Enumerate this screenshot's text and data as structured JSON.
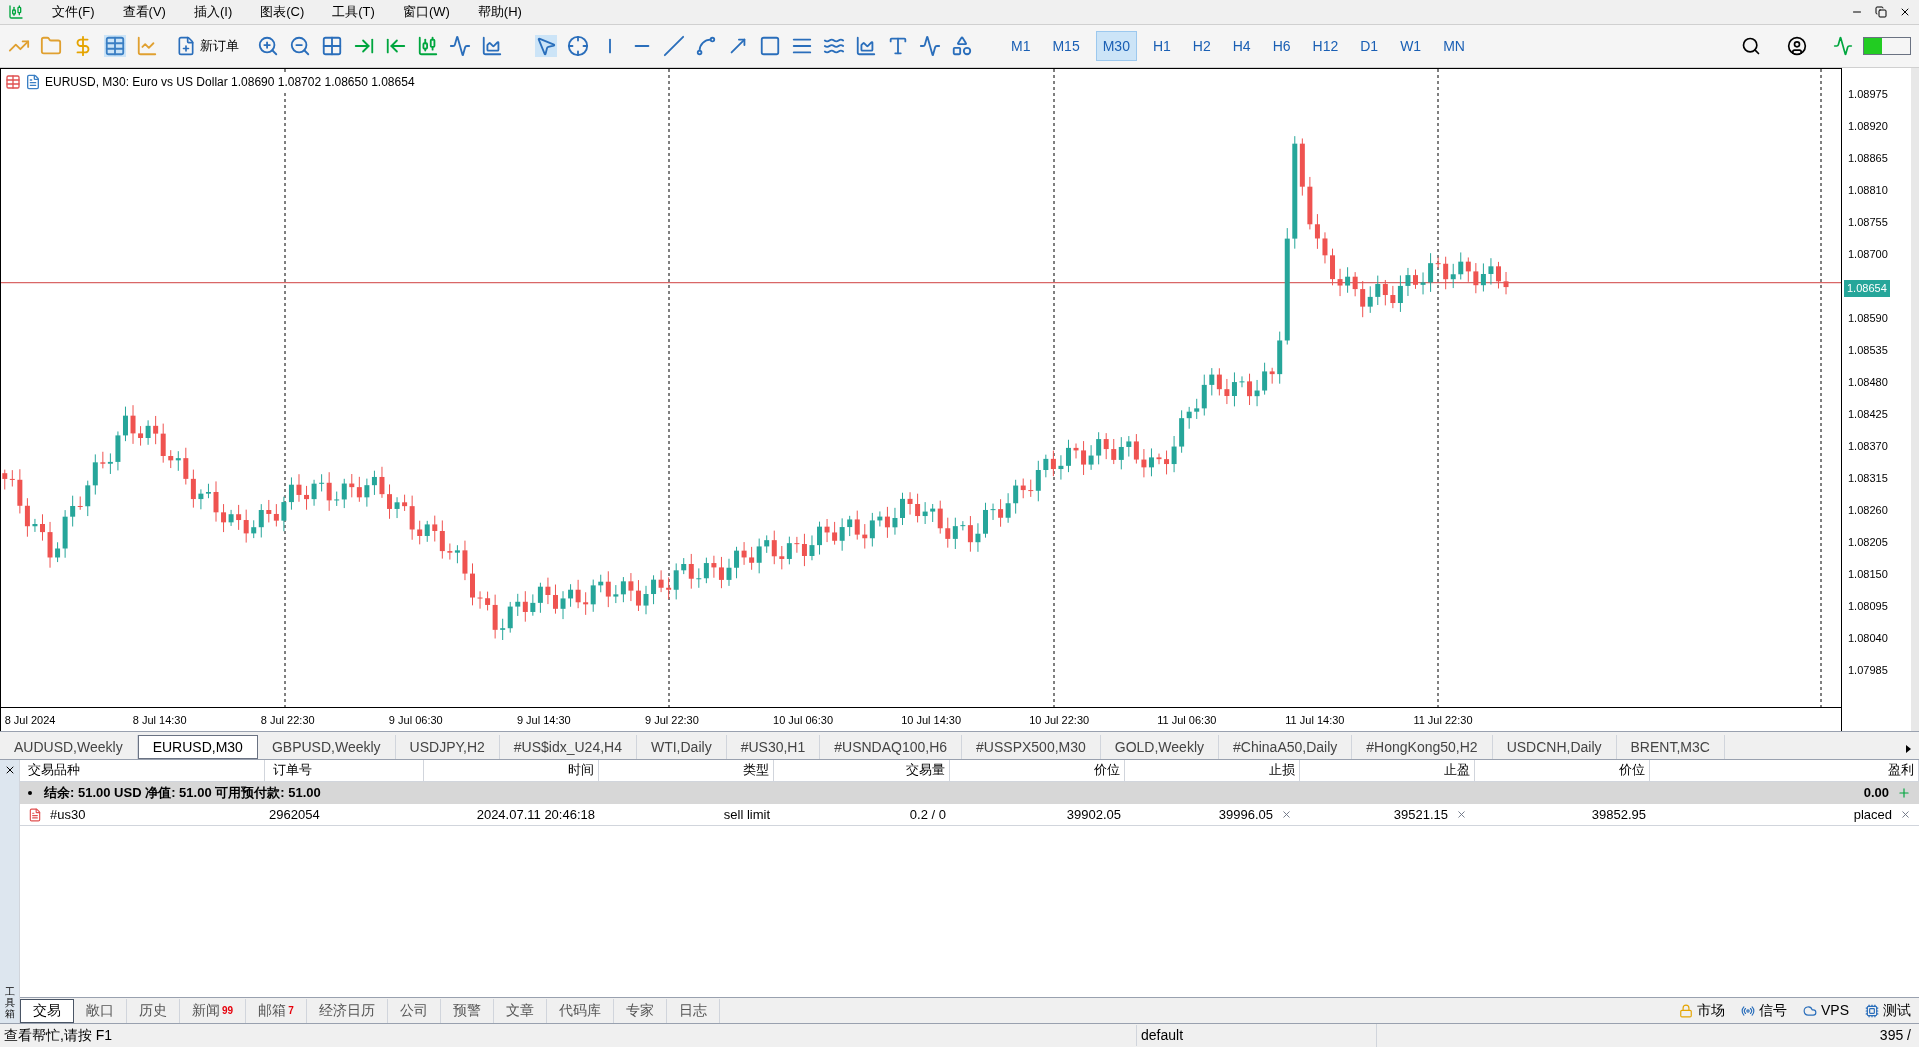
{
  "menu": [
    "文件(F)",
    "查看(V)",
    "插入(I)",
    "图表(C)",
    "工具(T)",
    "窗口(W)",
    "帮助(H)"
  ],
  "toolbar": {
    "new_order": "新订单",
    "timeframes": [
      {
        "label": "M1",
        "selected": false
      },
      {
        "label": "M15",
        "selected": false
      },
      {
        "label": "M30",
        "selected": true
      },
      {
        "label": "H1",
        "selected": false
      },
      {
        "label": "H2",
        "selected": false
      },
      {
        "label": "H4",
        "selected": false
      },
      {
        "label": "H6",
        "selected": false
      },
      {
        "label": "H12",
        "selected": false
      },
      {
        "label": "D1",
        "selected": false
      },
      {
        "label": "W1",
        "selected": false
      },
      {
        "label": "MN",
        "selected": false
      }
    ]
  },
  "chart": {
    "legend": "EURUSD, M30:  Euro vs US Dollar  1.08690 1.08702 1.08650 1.08654",
    "price_label": "1.08654",
    "y_ticks": [
      "1.08975",
      "1.08920",
      "1.08865",
      "1.08810",
      "1.08755",
      "1.08700",
      "1.08590",
      "1.08535",
      "1.08480",
      "1.08425",
      "1.08370",
      "1.08315",
      "1.08260",
      "1.08205",
      "1.08150",
      "1.08095",
      "1.08040",
      "1.07985"
    ],
    "x_labels": [
      "8 Jul 2024",
      "8 Jul 14:30",
      "8 Jul 22:30",
      "9 Jul 06:30",
      "9 Jul 14:30",
      "9 Jul 22:30",
      "10 Jul 06:30",
      "10 Jul 14:30",
      "10 Jul 22:30",
      "11 Jul 06:30",
      "11 Jul 14:30",
      "11 Jul 22:30"
    ]
  },
  "symbol_tabs": [
    {
      "label": "AUDUSD,Weekly",
      "selected": false
    },
    {
      "label": "EURUSD,M30",
      "selected": true
    },
    {
      "label": "GBPUSD,Weekly",
      "selected": false
    },
    {
      "label": "USDJPY,H2",
      "selected": false
    },
    {
      "label": "#US$idx_U24,H4",
      "selected": false
    },
    {
      "label": "WTI,Daily",
      "selected": false
    },
    {
      "label": "#US30,H1",
      "selected": false
    },
    {
      "label": "#USNDAQ100,H6",
      "selected": false
    },
    {
      "label": "#USSPX500,M30",
      "selected": false
    },
    {
      "label": "GOLD,Weekly",
      "selected": false
    },
    {
      "label": "#ChinaA50,Daily",
      "selected": false
    },
    {
      "label": "#HongKong50,H2",
      "selected": false
    },
    {
      "label": "USDCNH,Daily",
      "selected": false
    },
    {
      "label": "BRENT,M3C",
      "selected": false
    }
  ],
  "toolbox": {
    "title": "工具箱",
    "columns": [
      "交易品种",
      "订单号",
      "时间",
      "类型",
      "交易量",
      "价位",
      "止损",
      "止盈",
      "价位",
      "盈利"
    ],
    "summary": {
      "text": "结余: 51.00 USD  净值: 51.00  可用预付款: 51.00",
      "profit": "0.00"
    },
    "rows": [
      {
        "symbol": "#us30",
        "order": "2962054",
        "time": "2024.07.11 20:46:18",
        "type": "sell limit",
        "volume": "0.2 / 0",
        "price": "39902.05",
        "sl": "39996.05",
        "tp": "39521.15",
        "current": "39852.95",
        "profit": "placed"
      }
    ]
  },
  "bottom_tabs": [
    {
      "label": "交易",
      "selected": true
    },
    {
      "label": "敞口",
      "selected": false
    },
    {
      "label": "历史",
      "selected": false
    },
    {
      "label": "新闻",
      "badge": "99",
      "selected": false
    },
    {
      "label": "邮箱",
      "badge": "7",
      "selected": false
    },
    {
      "label": "经济日历",
      "selected": false
    },
    {
      "label": "公司",
      "selected": false
    },
    {
      "label": "预警",
      "selected": false
    },
    {
      "label": "文章",
      "selected": false
    },
    {
      "label": "代码库",
      "selected": false
    },
    {
      "label": "专家",
      "selected": false
    },
    {
      "label": "日志",
      "selected": false
    }
  ],
  "bottom_right": [
    "市场",
    "信号",
    "VPS",
    "测试"
  ],
  "status_bar": {
    "help": "查看帮忙,请按 F1",
    "profile": "default",
    "traffic": "395 /"
  }
}
